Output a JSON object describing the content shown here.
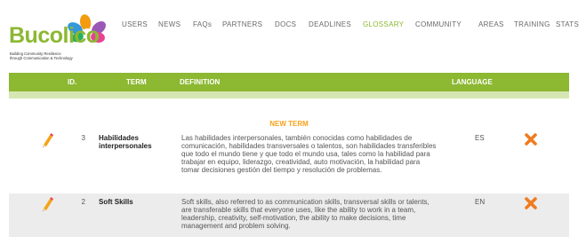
{
  "app": {
    "logo_text": "Bucolico",
    "logo_tagline_1": "Building Community Resilience",
    "logo_tagline_2": "through Communication & Technology"
  },
  "nav": [
    {
      "label": "USERS",
      "active": false
    },
    {
      "label": "NEWS",
      "active": false
    },
    {
      "label": "FAQs",
      "active": false
    },
    {
      "label": "PARTNERS",
      "active": false
    },
    {
      "label": "DOCS",
      "active": false
    },
    {
      "label": "DEADLINES",
      "active": false
    },
    {
      "label": "GLOSSARY",
      "active": true
    },
    {
      "label": "COMMUNITY",
      "active": false
    },
    {
      "label": "AREAS",
      "active": false
    },
    {
      "label": "TRAINING",
      "active": false
    },
    {
      "label": "STATS",
      "active": false
    }
  ],
  "table": {
    "headers": {
      "id": "ID.",
      "term": "TERM",
      "definition": "DEFINITION",
      "language": "LANGUAGE"
    },
    "new_term_label": "NEW TERM",
    "rows": [
      {
        "id": "3",
        "term": "Habilidades interpersonales",
        "definition": "Las habilidades interpersonales, también conocidas como habilidades de comunicación, habilidades transversales o talentos, son habilidades transferibles que todo el mundo tiene y que todo el mundo usa, tales como la habilidad para trabajar en equipo, liderazgo, creatividad, auto motivación, la habilidad para tomar decisiones gestión del tiempo y resolución de problemas.",
        "language": "ES"
      },
      {
        "id": "2",
        "term": "Soft Skills",
        "definition": "Soft skills, also referred to as communication skills, transversal skills or talents, are transferable skills that everyone uses, like the ability to work in a team, leadership, creativity, self-motivation, the ability to make decisions, time management and problem solving.",
        "language": "EN"
      }
    ]
  },
  "colors": {
    "brand_green": "#8cb832",
    "accent_orange": "#f5a31a",
    "delete_orange": "#f07b1f"
  },
  "icons": {
    "edit": "pencil-icon",
    "delete": "delete-x-icon"
  }
}
